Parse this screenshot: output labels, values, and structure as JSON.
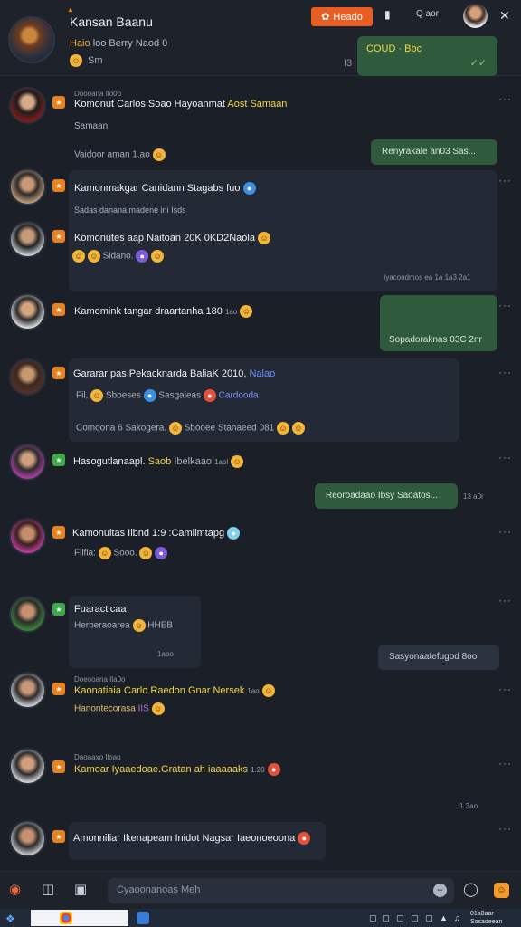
{
  "header": {
    "title": "Kansan Baanu",
    "subtitle_prefix": "Haio",
    "subtitle_rest": "loo Berry Naod 0",
    "status": "Sm",
    "pin_mark": "I3",
    "primary_button": "Heado",
    "search_label": "Q aor",
    "pinned": {
      "text": "COUD · Bbc",
      "ticks": "✓✓"
    }
  },
  "messages": [
    {
      "meta": "Doooana Ilo0o",
      "name": "Komonut Carlos Soao Hayoanmat",
      "name_suffix": "Aost Samaan",
      "line1": "Samaan",
      "line2": "Vaidoor aman 1.ao",
      "reply": "Renyrakale an03 Sas..."
    },
    {
      "name": "Kamonmakgar Canidann Stagabs",
      "name_suffix": "fuo",
      "line1": "Sadas danana madene ini Isds"
    },
    {
      "name": "Komonutes aap Naitoan 20K 0KD2Naola",
      "line1": "Sidano.",
      "line2": "Iyacoodmos ea 1a 1a3 2a1"
    },
    {
      "name": "Kamomink tangar draartanha 180",
      "name_suffix": "1ao",
      "reply": "Sopadoraknas 03C 2nr"
    },
    {
      "name": "Gararar pas Pekacknarda BaliaK 2010,",
      "name_suffix": "Nalao",
      "line1": "Fil,",
      "line1b": "Sboeses",
      "line1c": "Sasgaieas",
      "line1d": "Cardooda",
      "line2": "Comoona 6 Sakogera.",
      "line2b": "Sbooee",
      "line2c": "Stanaeed 081"
    },
    {
      "name": "Hasogutlanaapl.",
      "name_suffix": "Saob",
      "name_suffix2": "Ibelkaao",
      "name_suffix3": "1aol",
      "reply": "Reoroadaao Ibsy Saoatos...",
      "reply_time": "13 a0r"
    },
    {
      "name": "Kamonultas Ilbnd 1:9 :Camilmtapg",
      "line1": "Filfia:",
      "line1b": "Sooo."
    },
    {
      "name": "Fuaracticaa",
      "line1": "Herberaoarea",
      "line1b": "HHEB",
      "line2": "1abo",
      "reply": "Sasyonaatefugod 8oo"
    },
    {
      "meta": "Doeooana Ila0o",
      "name": "Kaonatiaia Carlo Raedon Gnar Nersek",
      "name_suffix": "1ao",
      "line1": "Hanontecorasa",
      "line1b": "IIS"
    },
    {
      "meta": "Daoaaxo Iloao",
      "name": "Kamoar Iyaaedoae.Gratan ah",
      "name_suffix": "iaaaaaks",
      "name_suffix2": "1.20",
      "line2": "1 3ao"
    },
    {
      "name": "Amonniliar Ikenapeam Inidot Nagsar Iaeonoeoona"
    }
  ],
  "composer": {
    "placeholder": "Cyaoonanoas Meh",
    "plus": "+",
    "sticker": "☺"
  },
  "taskbar": {
    "time_line1": "01a0aar",
    "time_line2": "Sosadeean"
  },
  "colors": {
    "accent": "#e85d24",
    "bubble_sent": "#2f5a3c",
    "background": "#1b2028",
    "badge": "#e8811f"
  }
}
